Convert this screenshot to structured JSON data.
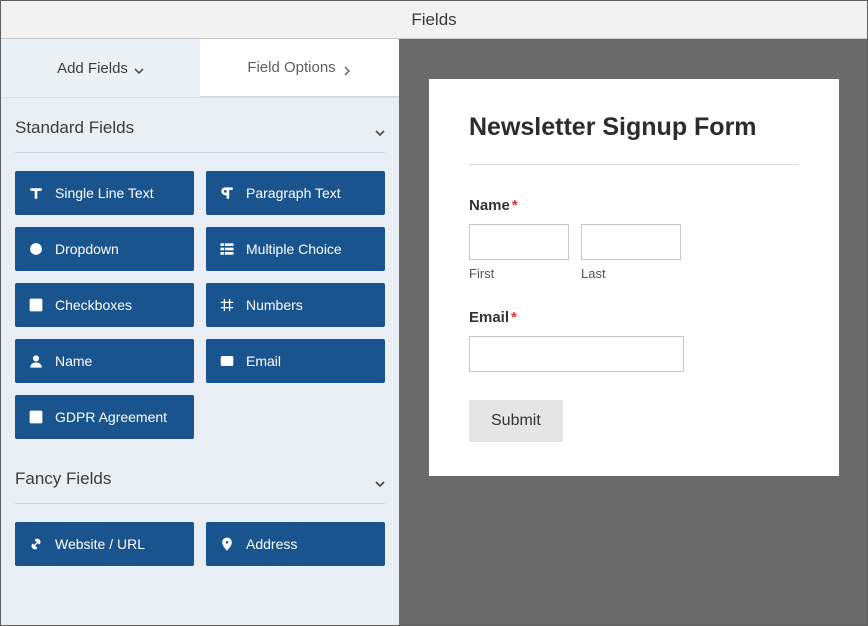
{
  "titlebar": {
    "title": "Fields"
  },
  "tabs": {
    "add": {
      "label": "Add Fields"
    },
    "options": {
      "label": "Field Options"
    }
  },
  "sections": {
    "standard": {
      "title": "Standard Fields",
      "items": [
        {
          "icon": "text-icon",
          "label": "Single Line Text"
        },
        {
          "icon": "paragraph-icon",
          "label": "Paragraph Text"
        },
        {
          "icon": "dropdown-icon",
          "label": "Dropdown"
        },
        {
          "icon": "multiple-icon",
          "label": "Multiple Choice"
        },
        {
          "icon": "checkboxes-icon",
          "label": "Checkboxes"
        },
        {
          "icon": "numbers-icon",
          "label": "Numbers"
        },
        {
          "icon": "name-icon",
          "label": "Name"
        },
        {
          "icon": "email-icon",
          "label": "Email"
        },
        {
          "icon": "gdpr-icon",
          "label": "GDPR Agreement"
        }
      ]
    },
    "fancy": {
      "title": "Fancy Fields",
      "items": [
        {
          "icon": "url-icon",
          "label": "Website / URL"
        },
        {
          "icon": "address-icon",
          "label": "Address"
        }
      ]
    }
  },
  "form": {
    "title": "Newsletter Signup Form",
    "name": {
      "label": "Name",
      "required_mark": "*",
      "first_sublabel": "First",
      "last_sublabel": "Last"
    },
    "email": {
      "label": "Email",
      "required_mark": "*"
    },
    "submit_label": "Submit"
  },
  "colors": {
    "chip_bg": "#1a548f"
  }
}
